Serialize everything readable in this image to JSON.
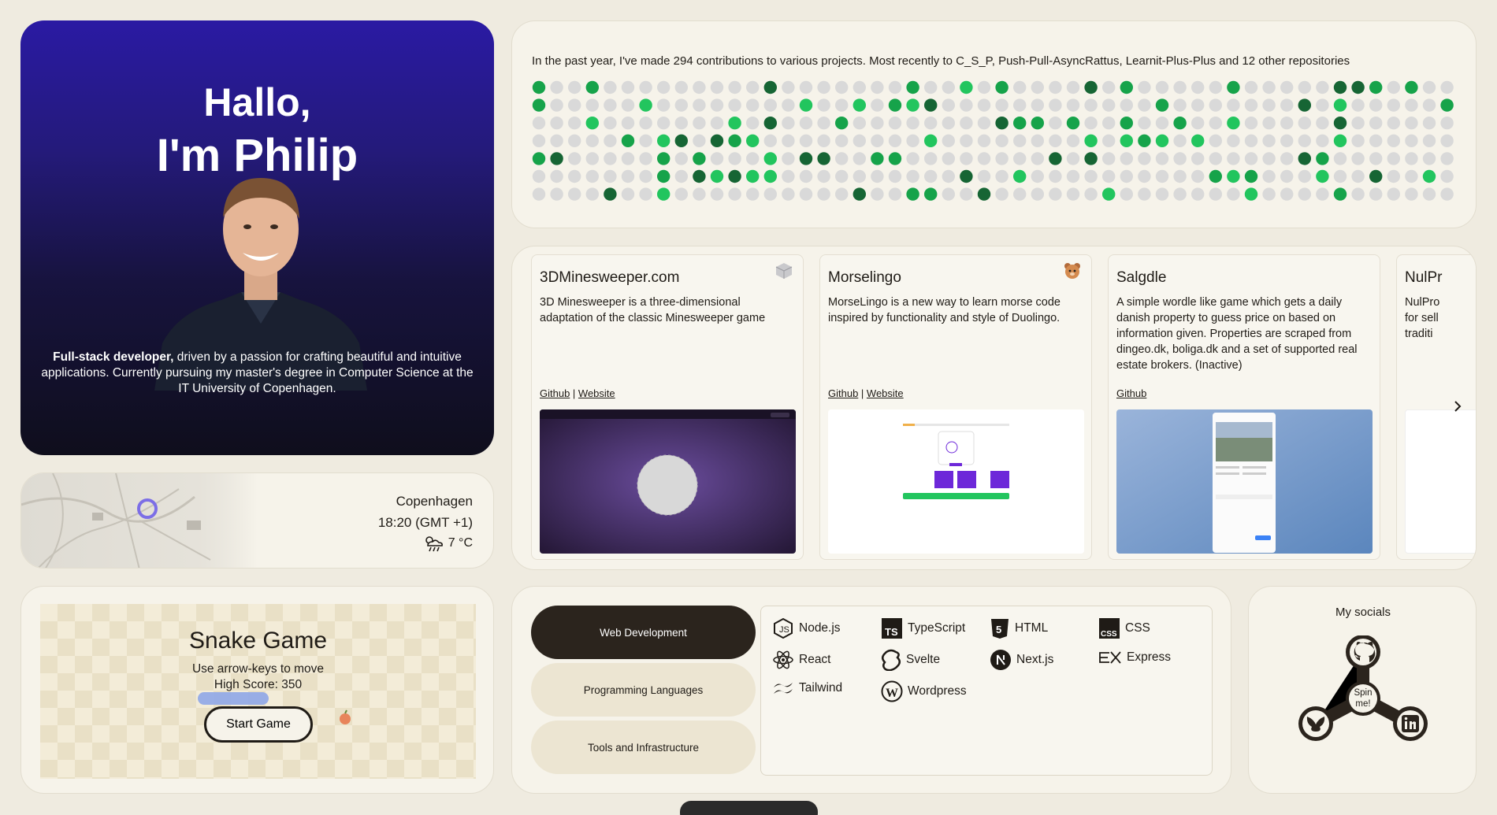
{
  "hero": {
    "greeting": "Hallo,",
    "name": "I'm Philip",
    "bio_strong": "Full-stack developer,",
    "bio_rest": " driven by a passion for crafting beautiful and intuitive applications. Currently pursuing my master's degree in Computer Science at the IT University of Copenhagen."
  },
  "location": {
    "city": "Copenhagen",
    "time": "18:20 (GMT +1)",
    "temperature": "7 °C",
    "weather_icon": "cloud-sun-rain-icon"
  },
  "snake": {
    "title": "Snake Game",
    "hint": "Use arrow-keys to move",
    "high_score": "High Score: 350",
    "start_label": "Start Game"
  },
  "contributions": {
    "summary": "In the past year, I've made 294 contributions to various projects. Most recently to C_S_P, Push-Pull-AsyncRattus, Learnit-Plus-Plus and 12 other repositories",
    "levels_legend": {
      "0": "#d9d9d9",
      "1": "#22c55e",
      "2": "#16a34a",
      "3": "#166534"
    }
  },
  "projects": {
    "items": [
      {
        "title": "3DMinesweeper.com",
        "description": "3D Minesweeper is a three-dimensional adaptation of the classic Minesweeper game",
        "link1": "Github",
        "sep": " | ",
        "link2": "Website"
      },
      {
        "title": "Morselingo",
        "description": "MorseLingo is a new way to learn morse code inspired by functionality and style of Duolingo.",
        "link1": "Github",
        "sep": " | ",
        "link2": "Website"
      },
      {
        "title": "Salgdle",
        "description": "A simple wordle like game which gets a daily danish property to guess price on based on information given. Properties are scraped from dingeo.dk, boliga.dk and a set of supported real estate brokers. (Inactive)",
        "link1": "Github"
      },
      {
        "title": "NulPr",
        "description": "NulPro for sell traditi"
      }
    ],
    "next_icon": "chevron-right-icon"
  },
  "skills": {
    "categories": [
      "Web Development",
      "Programming Languages",
      "Tools and Infrastructure"
    ],
    "active_category": "Web Development",
    "items": [
      "Node.js",
      "TypeScript",
      "HTML",
      "CSS",
      "React",
      "Svelte",
      "Next.js",
      "Express",
      "Tailwind",
      "Wordpress"
    ]
  },
  "socials": {
    "title": "My socials",
    "spin_label": "Spin me!",
    "links": [
      "github-icon",
      "bluesky-icon",
      "linkedin-icon"
    ]
  }
}
